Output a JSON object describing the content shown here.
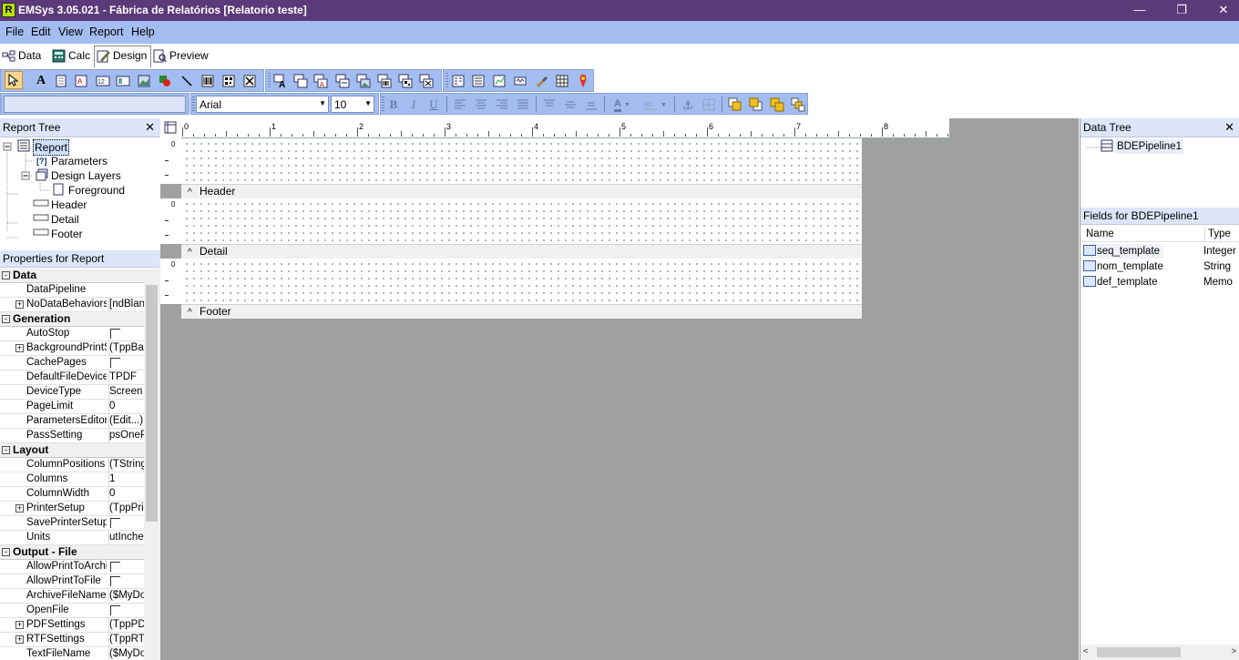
{
  "window": {
    "title": "EMSys 3.05.021 - Fábrica de Relatórios [Relatorio teste]",
    "app_icon": "R"
  },
  "menu": [
    "File",
    "Edit",
    "View",
    "Report",
    "Help"
  ],
  "tabs": [
    {
      "label": "Data",
      "icon": "data-icon"
    },
    {
      "label": "Calc",
      "icon": "calc-icon"
    },
    {
      "label": "Design",
      "icon": "design-icon",
      "active": true
    },
    {
      "label": "Preview",
      "icon": "preview-icon"
    }
  ],
  "format_bar": {
    "font_name": "Arial",
    "font_size": "10"
  },
  "report_tree": {
    "title": "Report Tree",
    "nodes": [
      "Report",
      "Parameters",
      "Design Layers",
      "Foreground",
      "Header",
      "Detail",
      "Footer"
    ]
  },
  "properties": {
    "title": "Properties for Report",
    "categories": [
      {
        "name": "Data",
        "rows": [
          {
            "name": "DataPipeline",
            "value": ""
          },
          {
            "name": "NoDataBehaviors",
            "value": "[ndBlank",
            "expand": true
          }
        ]
      },
      {
        "name": "Generation",
        "rows": [
          {
            "name": "AutoStop",
            "checkbox": true
          },
          {
            "name": "BackgroundPrintSe",
            "value": "(TppBac",
            "expand": true
          },
          {
            "name": "CachePages",
            "checkbox": true
          },
          {
            "name": "DefaultFileDevice",
            "value": "TPDF"
          },
          {
            "name": "DeviceType",
            "value": "Screen"
          },
          {
            "name": "PageLimit",
            "value": "0"
          },
          {
            "name": "ParametersEditor",
            "value": "(Edit...)"
          },
          {
            "name": "PassSetting",
            "value": "psOnePa"
          }
        ]
      },
      {
        "name": "Layout",
        "rows": [
          {
            "name": "ColumnPositions",
            "value": "(TString"
          },
          {
            "name": "Columns",
            "value": "1"
          },
          {
            "name": "ColumnWidth",
            "value": "0"
          },
          {
            "name": "PrinterSetup",
            "value": "(TppPrin",
            "expand": true
          },
          {
            "name": "SavePrinterSetup",
            "checkbox": true
          },
          {
            "name": "Units",
            "value": "utInches"
          }
        ]
      },
      {
        "name": "Output - File",
        "rows": [
          {
            "name": "AllowPrintToArchiv",
            "checkbox": true
          },
          {
            "name": "AllowPrintToFile",
            "checkbox": true
          },
          {
            "name": "ArchiveFileName",
            "value": "($MyDoc"
          },
          {
            "name": "OpenFile",
            "checkbox": true
          },
          {
            "name": "PDFSettings",
            "value": "(TppPDF",
            "expand": true
          },
          {
            "name": "RTFSettings",
            "value": "(TppRTF",
            "expand": true
          },
          {
            "name": "TextFileName",
            "value": "($MyDoc"
          }
        ]
      }
    ]
  },
  "ruler": {
    "numbers": [
      "0",
      "1",
      "2",
      "3",
      "4",
      "5",
      "6",
      "7",
      "8"
    ]
  },
  "bands": {
    "header": "Header",
    "detail": "Detail",
    "footer": "Footer",
    "vruler_zero": "0"
  },
  "data_tree": {
    "title": "Data Tree",
    "pipeline": "BDEPipeline1",
    "fields_title": "Fields for BDEPipeline1",
    "col_name": "Name",
    "col_type": "Type",
    "fields": [
      {
        "name": "seq_template",
        "type": "Integer"
      },
      {
        "name": "nom_template",
        "type": "String"
      },
      {
        "name": "def_template",
        "type": "Memo"
      }
    ]
  },
  "colors": {
    "titlebar": "#5b3a7a",
    "menubar": "#a3bdf0",
    "workspace": "#a0a0a0"
  }
}
